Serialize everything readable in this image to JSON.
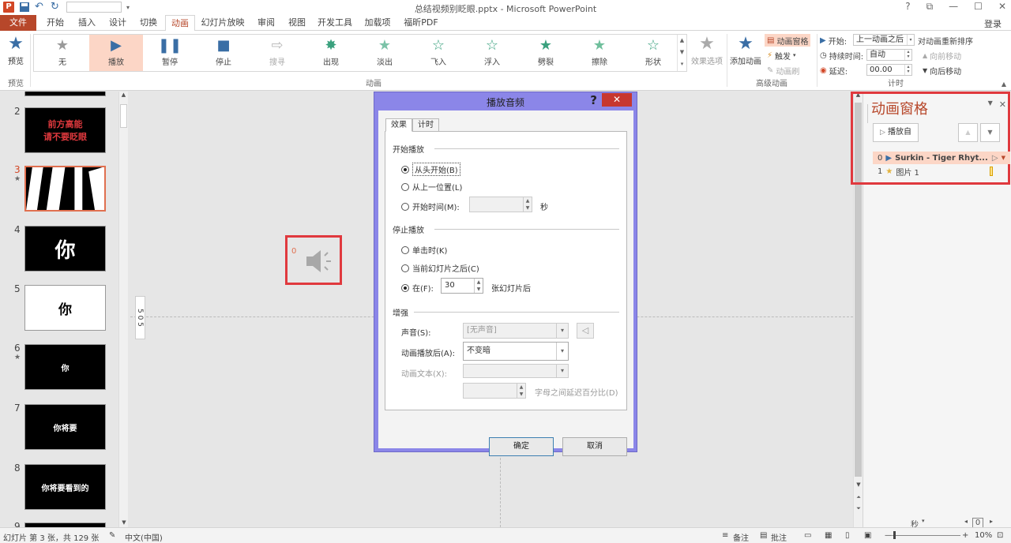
{
  "window": {
    "title": "总结视频别眨眼.pptx - Microsoft PowerPoint",
    "login": "登录",
    "controls": [
      "?",
      "⧉",
      "—",
      "☐",
      "✕"
    ]
  },
  "tabs": [
    "文件",
    "开始",
    "插入",
    "设计",
    "切换",
    "动画",
    "幻灯片放映",
    "审阅",
    "视图",
    "开发工具",
    "加载项",
    "福昕PDF"
  ],
  "ribbon": {
    "preview_label": "预览",
    "preview_group": "预览",
    "animation_group": "动画",
    "gallery": [
      {
        "label": "无",
        "icon": "★",
        "color": "#9a9a9a"
      },
      {
        "label": "播放",
        "icon": "▶",
        "color": "#3a6ea5"
      },
      {
        "label": "暂停",
        "icon": "❚❚",
        "color": "#3a6ea5"
      },
      {
        "label": "停止",
        "icon": "■",
        "color": "#3a6ea5"
      },
      {
        "label": "搜寻",
        "icon": "⇨",
        "color": "#bbbbbb"
      },
      {
        "label": "出现",
        "icon": "✸",
        "color": "#3aa17e"
      },
      {
        "label": "淡出",
        "icon": "★",
        "color": "#7cc3a8"
      },
      {
        "label": "飞入",
        "icon": "☆",
        "color": "#3aa17e"
      },
      {
        "label": "浮入",
        "icon": "☆",
        "color": "#3aa17e"
      },
      {
        "label": "劈裂",
        "icon": "★",
        "color": "#3aa17e"
      },
      {
        "label": "擦除",
        "icon": "★",
        "color": "#6fbf9c"
      },
      {
        "label": "形状",
        "icon": "☆",
        "color": "#3aa17e"
      }
    ],
    "effect_options": "效果选项",
    "add_animation": "添加动画",
    "animation_pane": "动画窗格",
    "trigger": "触发",
    "animation_painter": "动画刷",
    "advanced_group": "高级动画",
    "start_label": "开始:",
    "start_value": "上一动画之后",
    "duration_label": "持续时间:",
    "duration_value": "自动",
    "delay_label": "延迟:",
    "delay_value": "00.00",
    "reorder_label": "对动画重新排序",
    "move_earlier": "向前移动",
    "move_later": "向后移动",
    "timing_group": "计时"
  },
  "slides": [
    {
      "num": "1",
      "text": "",
      "white": false
    },
    {
      "num": "2",
      "text": "前方高能\n请不要眨眼",
      "white": false,
      "red": true
    },
    {
      "num": "3",
      "text": "",
      "white": false,
      "selected": true,
      "star": "★"
    },
    {
      "num": "4",
      "text": "你",
      "white": false
    },
    {
      "num": "5",
      "text": "你",
      "white": true
    },
    {
      "num": "6",
      "text": "你",
      "white": false,
      "star": "★"
    },
    {
      "num": "7",
      "text": "你将要",
      "white": false
    },
    {
      "num": "8",
      "text": "你将要看到的",
      "white": false
    },
    {
      "num": "9",
      "text": "",
      "white": false
    }
  ],
  "editor": {
    "audio_order": "0",
    "ruler": "5 0 5"
  },
  "anim_pane": {
    "title": "动画窗格",
    "play_from": "播放自",
    "items": [
      {
        "order": "0",
        "name": "Surkin - Tiger Rhyt...",
        "selected": true
      },
      {
        "order": "1",
        "name": "图片 1",
        "selected": false
      }
    ],
    "seconds": "秒",
    "zoom_value": "0"
  },
  "status": {
    "slide_info": "幻灯片 第 3 张，共 129 张",
    "language": "中文(中国)",
    "notes": "备注",
    "comments": "批注",
    "zoom": "10%"
  },
  "dialog": {
    "title": "播放音频",
    "help": "?",
    "close": "✕",
    "tabs": [
      "效果",
      "计时"
    ],
    "start_section": "开始播放",
    "start_options": [
      "从头开始(B)",
      "从上一位置(L)",
      "开始时间(M):"
    ],
    "start_time_unit": "秒",
    "stop_section": "停止播放",
    "stop_options": [
      "单击时(K)",
      "当前幻灯片之后(C)",
      "在(F):"
    ],
    "stop_after_value": "30",
    "stop_after_unit": "张幻灯片后",
    "enhance_section": "增强",
    "sound_label": "声音(S):",
    "sound_value": "[无声音]",
    "after_anim_label": "动画播放后(A):",
    "after_anim_value": "不变暗",
    "anim_text_label": "动画文本(X):",
    "delay_between_letters": "字母之间延迟百分比(D)",
    "ok": "确定",
    "cancel": "取消"
  }
}
